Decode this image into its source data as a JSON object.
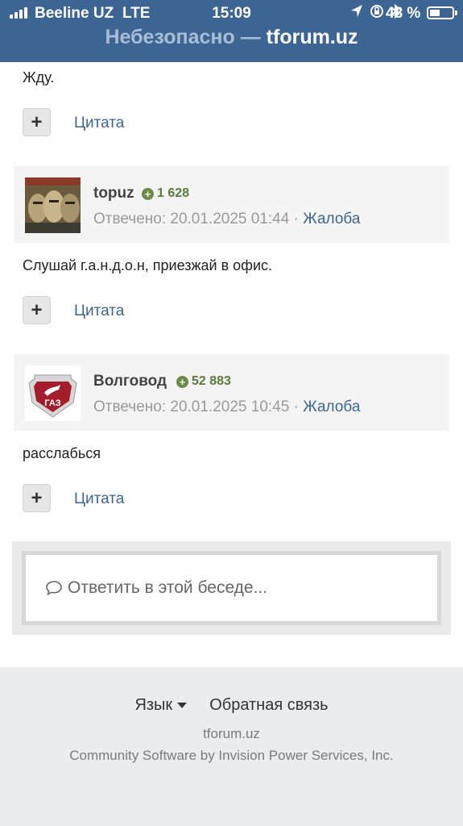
{
  "status_bar": {
    "carrier": "Beeline UZ",
    "network": "LTE",
    "time": "15:09",
    "battery_percent": "48 %",
    "battery_level": 0.48,
    "icons": [
      "location-arrow-icon",
      "orientation-lock-icon",
      "bluetooth-icon"
    ]
  },
  "browser": {
    "insecure_label": "Небезопасно —",
    "host": "tforum.uz"
  },
  "posts": [
    {
      "body": "Жду.",
      "quote_label": "Цитата"
    },
    {
      "author": "topuz",
      "reputation": "1 628",
      "replied": "Отвечено: 20.01.2025 01:44",
      "separator": "·",
      "report_label": "Жалоба",
      "body": "Слушай г.а.н.д.о.н, приезжай в офис.",
      "quote_label": "Цитата"
    },
    {
      "author": "Волговод",
      "reputation": "52 883",
      "replied": "Отвечено: 20.01.2025 10:45",
      "separator": "·",
      "report_label": "Жалоба",
      "body": "расслабься",
      "quote_label": "Цитата",
      "avatar_text": "ГАЗ"
    }
  ],
  "reply": {
    "placeholder": "Ответить в этой беседе...",
    "icon": "comment-bubble-icon"
  },
  "footer": {
    "language_label": "Язык",
    "feedback_label": "Обратная связь",
    "site": "tforum.uz",
    "copyright": "Community Software by Invision Power Services, Inc."
  },
  "colors": {
    "header_bg": "#3d6594",
    "link": "#3d6594",
    "reputation": "#5a7a3e"
  }
}
